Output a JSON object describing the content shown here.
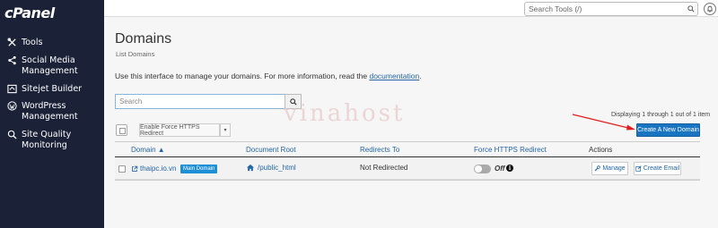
{
  "sidebar": {
    "logo": "cPanel",
    "items": [
      {
        "label": "Tools",
        "icon": "tools-icon"
      },
      {
        "label": "Social Media Management",
        "icon": "share-icon"
      },
      {
        "label": "Sitejet Builder",
        "icon": "sitejet-icon"
      },
      {
        "label": "WordPress Management",
        "icon": "wordpress-icon"
      },
      {
        "label": "Site Quality Monitoring",
        "icon": "monitoring-icon"
      }
    ]
  },
  "topbar": {
    "search_placeholder": "Search Tools (/)",
    "search_icon": "search-icon",
    "notifications_icon": "bell-icon"
  },
  "page": {
    "title": "Domains",
    "subtitle": "List Domains",
    "description_pre": "Use this interface to manage your domains. For more information, read the ",
    "description_link": "documentation",
    "description_post": "."
  },
  "search": {
    "placeholder": "Search"
  },
  "watermark": "vinahost",
  "toolbar": {
    "force_https_label": "Enable Force HTTPS Redirect",
    "caret": "▾",
    "displaying": "Displaying 1 through 1 out of 1 item",
    "create_label": "Create A New Domain"
  },
  "table": {
    "headers": [
      "Domain ▲",
      "Document Root",
      "Redirects To",
      "Force HTTPS Redirect",
      "Actions"
    ],
    "rows": [
      {
        "domain": "thaipc.io.vn",
        "badge": "Main Domain",
        "document_root": "/public_html",
        "redirects_to": "Not Redirected",
        "force_https": "Off",
        "force_https_enabled": false,
        "actions": [
          "Manage",
          "Create Email"
        ]
      }
    ]
  },
  "colors": {
    "sidebar_bg": "#1b2238",
    "accent_blue": "#1975c1",
    "link_blue": "#2465a6",
    "badge_blue": "#1d8fd6",
    "annotation_red": "#e02020"
  }
}
